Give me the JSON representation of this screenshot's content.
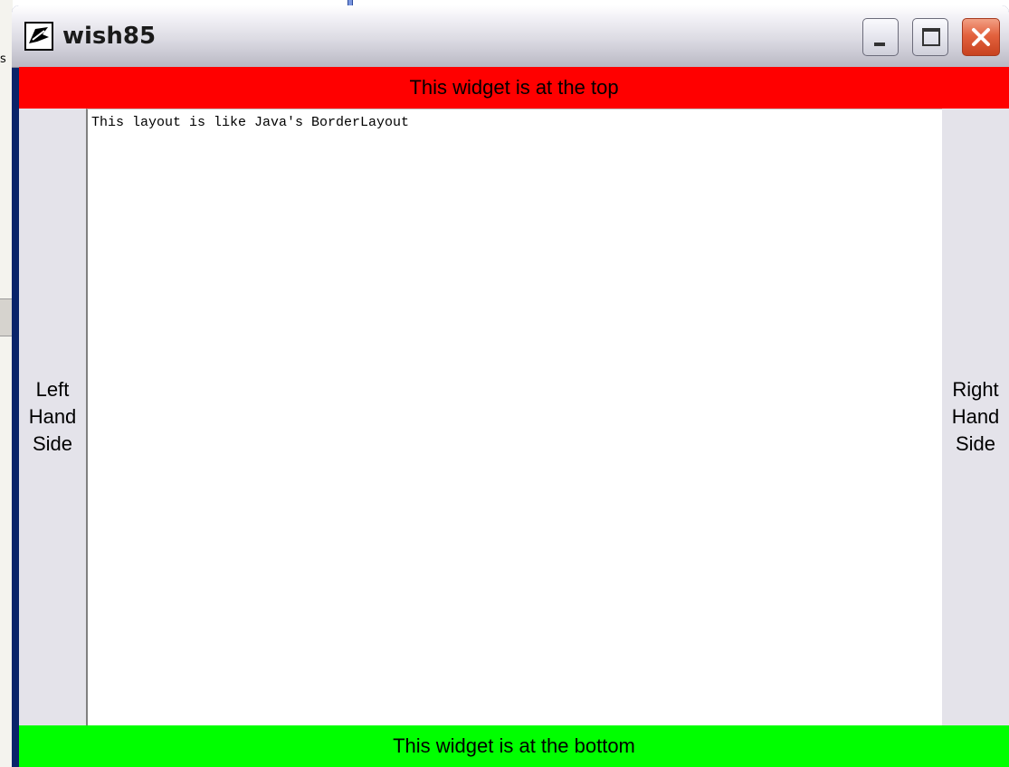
{
  "background": {
    "fragment_text": "s"
  },
  "window": {
    "title": "wish85",
    "icon": "tk-feather-icon",
    "buttons": {
      "minimize": "minimize-icon",
      "maximize": "maximize-icon",
      "close": "close-icon"
    }
  },
  "layout": {
    "top_label": "This widget is at the top",
    "top_color": "#ff0000",
    "left_lines": [
      "Left",
      "Hand",
      "Side"
    ],
    "right_lines": [
      "Right",
      "Hand",
      "Side"
    ],
    "center_text": "This layout is like Java's BorderLayout",
    "bottom_label": "This widget is at the bottom",
    "bottom_color": "#00ff00"
  }
}
